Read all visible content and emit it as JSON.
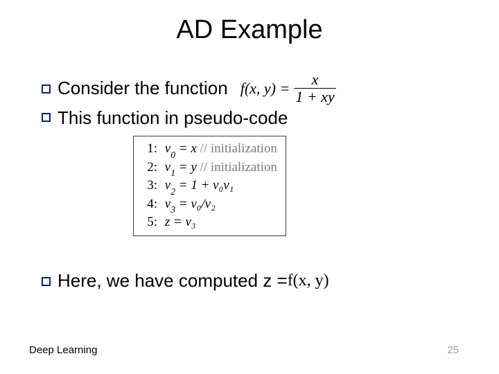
{
  "title": "AD Example",
  "bullets": {
    "b1_text": "Consider the function",
    "b2_text": "This function in pseudo-code",
    "b3_prefix": "Here, we have computed z = ",
    "b3_fn": "f(x, y)"
  },
  "formula": {
    "lhs": "f(x, y) = ",
    "num": "x",
    "den": "1 + xy"
  },
  "code": {
    "lines": [
      {
        "n": "1:",
        "body_var": "v",
        "body_sub": "0",
        "body_rest": " = x",
        "comment": " // initialization"
      },
      {
        "n": "2:",
        "body_var": "v",
        "body_sub": "1",
        "body_rest": " = y",
        "comment": " // initialization"
      },
      {
        "n": "3:",
        "body_var": "v",
        "body_sub": "2",
        "body_rest": " = 1 + v₀v₁",
        "comment": ""
      },
      {
        "n": "4:",
        "body_var": "v",
        "body_sub": "3",
        "body_rest": " = v₀/v₂",
        "comment": ""
      },
      {
        "n": "5:",
        "body_var": "z",
        "body_sub": "",
        "body_rest": " = v₃",
        "comment": ""
      }
    ]
  },
  "footer": {
    "left": "Deep Learning",
    "page": "25"
  }
}
